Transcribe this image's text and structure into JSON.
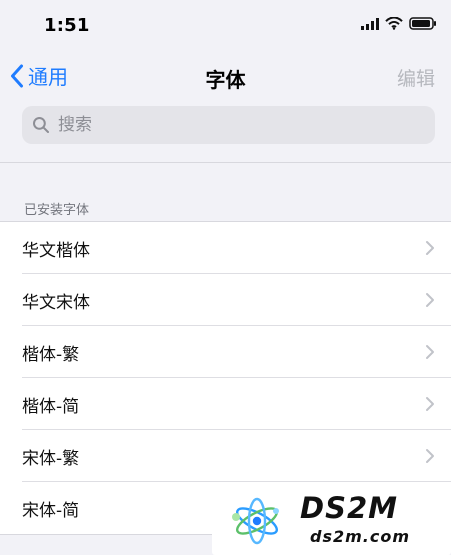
{
  "status_bar": {
    "time": "1:51"
  },
  "navigation": {
    "back_label": "通用",
    "title": "字体",
    "edit_label": "编辑"
  },
  "search": {
    "placeholder": "搜索"
  },
  "installed_fonts": {
    "section_title": "已安装字体",
    "items": [
      {
        "label": "华文楷体"
      },
      {
        "label": "华文宋体"
      },
      {
        "label": "楷体-繁"
      },
      {
        "label": "楷体-简"
      },
      {
        "label": "宋体-繁"
      },
      {
        "label": "宋体-简"
      }
    ]
  },
  "watermark": {
    "brand": "DS2M",
    "domain": "ds2m.com"
  },
  "colors": {
    "accent": "#1f7cff",
    "background": "#f2f2f7",
    "muted": "#b6b8be"
  }
}
